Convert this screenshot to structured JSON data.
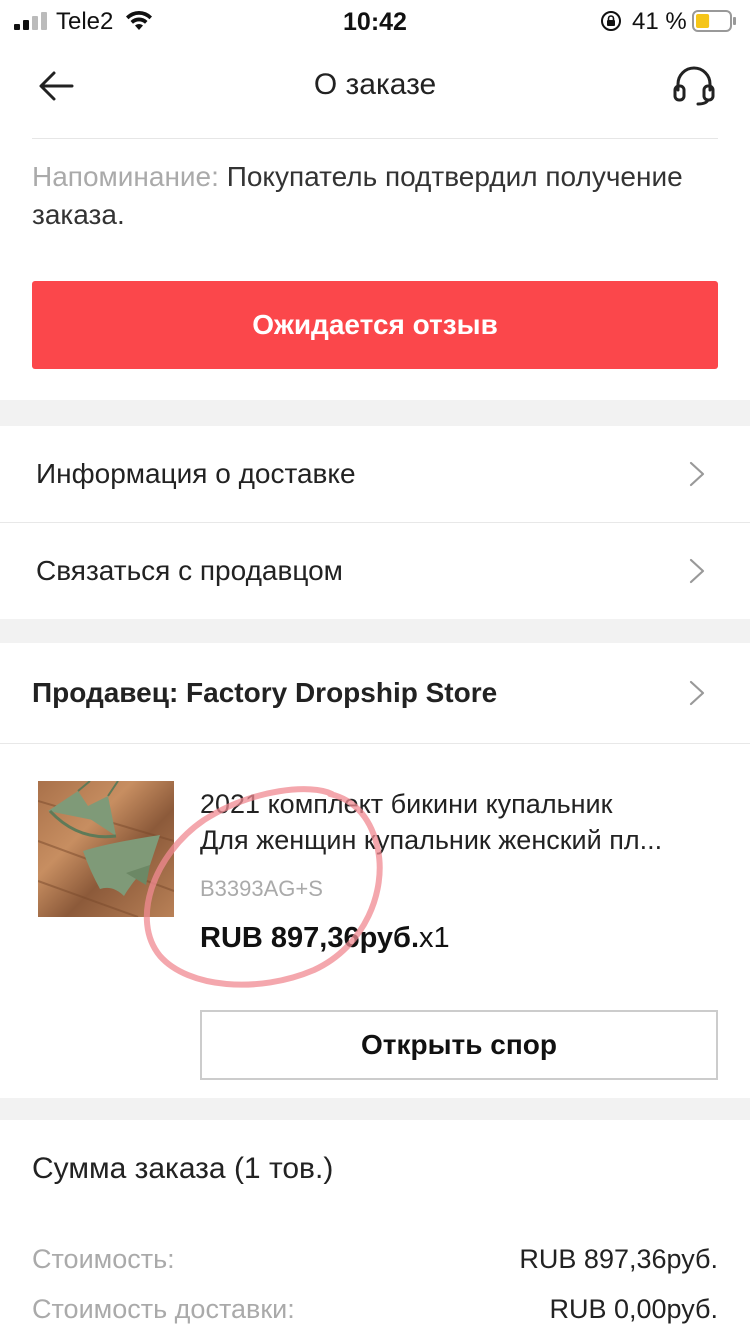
{
  "status_bar": {
    "carrier": "Tele2",
    "time": "10:42",
    "battery_percent": "41 %",
    "battery_level": 0.41,
    "battery_color": "#f5c518"
  },
  "nav": {
    "title": "О заказе",
    "back_icon": "arrow-left-icon",
    "support_icon": "headset-icon"
  },
  "reminder": {
    "label": "Напоминание:",
    "text": " Покупатель подтвердил получение заказа."
  },
  "review_button": {
    "label": "Ожидается отзыв",
    "color": "#fb474b"
  },
  "menu": {
    "delivery_info": "Информация о доставке",
    "contact_seller": "Связаться с продавцом"
  },
  "seller": {
    "label": "Продавец: Factory Dropship Store"
  },
  "product": {
    "title_line1": "2021 комплект бикини купальник",
    "title_line2": "Для женщин купальник женский пл...",
    "sku": "B3393AG+S",
    "price": "RUB 897,36руб.",
    "quantity": "x1"
  },
  "dispute_button": {
    "label": "Открыть спор"
  },
  "summary": {
    "title": "Сумма заказа (1 тов.)",
    "rows": [
      {
        "label": "Стоимость:",
        "value": "RUB 897,36руб."
      },
      {
        "label": "Стоимость доставки:",
        "value": "RUB 0,00руб."
      }
    ]
  }
}
